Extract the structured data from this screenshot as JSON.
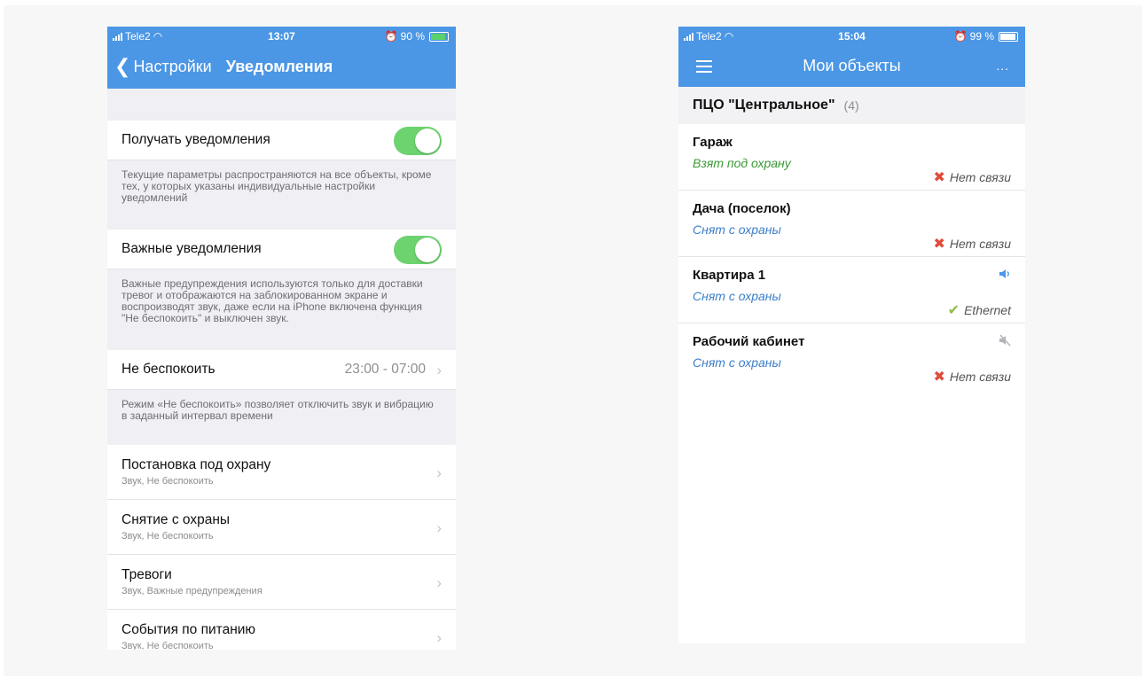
{
  "left": {
    "status": {
      "carrier": "Tele2",
      "time": "13:07",
      "battery": "90 %",
      "battery_level": 0.9
    },
    "nav": {
      "back_label": "Настройки",
      "title": "Уведомления"
    },
    "receive": {
      "label": "Получать уведомления",
      "enabled": true
    },
    "receive_note": "Текущие параметры распространяются на все объекты, кроме тех, у которых указаны индивидуальные настройки уведомлений",
    "critical": {
      "label": "Важные уведомления",
      "enabled": true
    },
    "critical_note": "Важные предупреждения используются только для доставки тревог и отображаются на заблокированном экране и воспроизводят звук, даже если на iPhone включена функция \"Не беспокоить\" и выключен звук.",
    "dnd": {
      "label": "Не беспокоить",
      "value": "23:00 - 07:00"
    },
    "dnd_note": "Режим «Не беспокоить» позволяет отключить звук и вибрацию в заданный интервал времени",
    "events": [
      {
        "label": "Постановка под охрану",
        "sub": "Звук, Не беспокоить"
      },
      {
        "label": "Снятие с охраны",
        "sub": "Звук, Не беспокоить"
      },
      {
        "label": "Тревоги",
        "sub": "Звук, Важные предупреждения"
      },
      {
        "label": "События по питанию",
        "sub": "Звук, Не беспокоить"
      }
    ]
  },
  "right": {
    "status": {
      "carrier": "Tele2",
      "time": "15:04",
      "battery": "99 %",
      "battery_level": 0.99
    },
    "nav": {
      "title": "Мои объекты",
      "more": "..."
    },
    "group": {
      "name": "ПЦО \"Центральное\"",
      "count": "(4)"
    },
    "objects": [
      {
        "name": "Гараж",
        "state": "Взят под охрану",
        "connection": "Нет связи",
        "conn_icon": "x-icon",
        "sound_icon": ""
      },
      {
        "name": "Дача (поселок)",
        "state": "Снят с охраны",
        "connection": "Нет связи",
        "conn_icon": "x-icon",
        "sound_icon": ""
      },
      {
        "name": "Квартира 1",
        "state": "Снят с охраны",
        "connection": "Ethernet",
        "conn_icon": "check-icon",
        "sound_icon": "speaker-icon"
      },
      {
        "name": "Рабочий кабинет",
        "state": "Снят с охраны",
        "connection": "Нет связи",
        "conn_icon": "x-icon",
        "sound_icon": "speaker-muted-icon"
      }
    ]
  },
  "colors": {
    "accent": "#4b97e6",
    "toggle_on": "#6cd36f",
    "armed": "#3a9a34",
    "disarmed": "#3b7ec9",
    "error": "#e04b3a",
    "ok": "#8cbf4a"
  }
}
